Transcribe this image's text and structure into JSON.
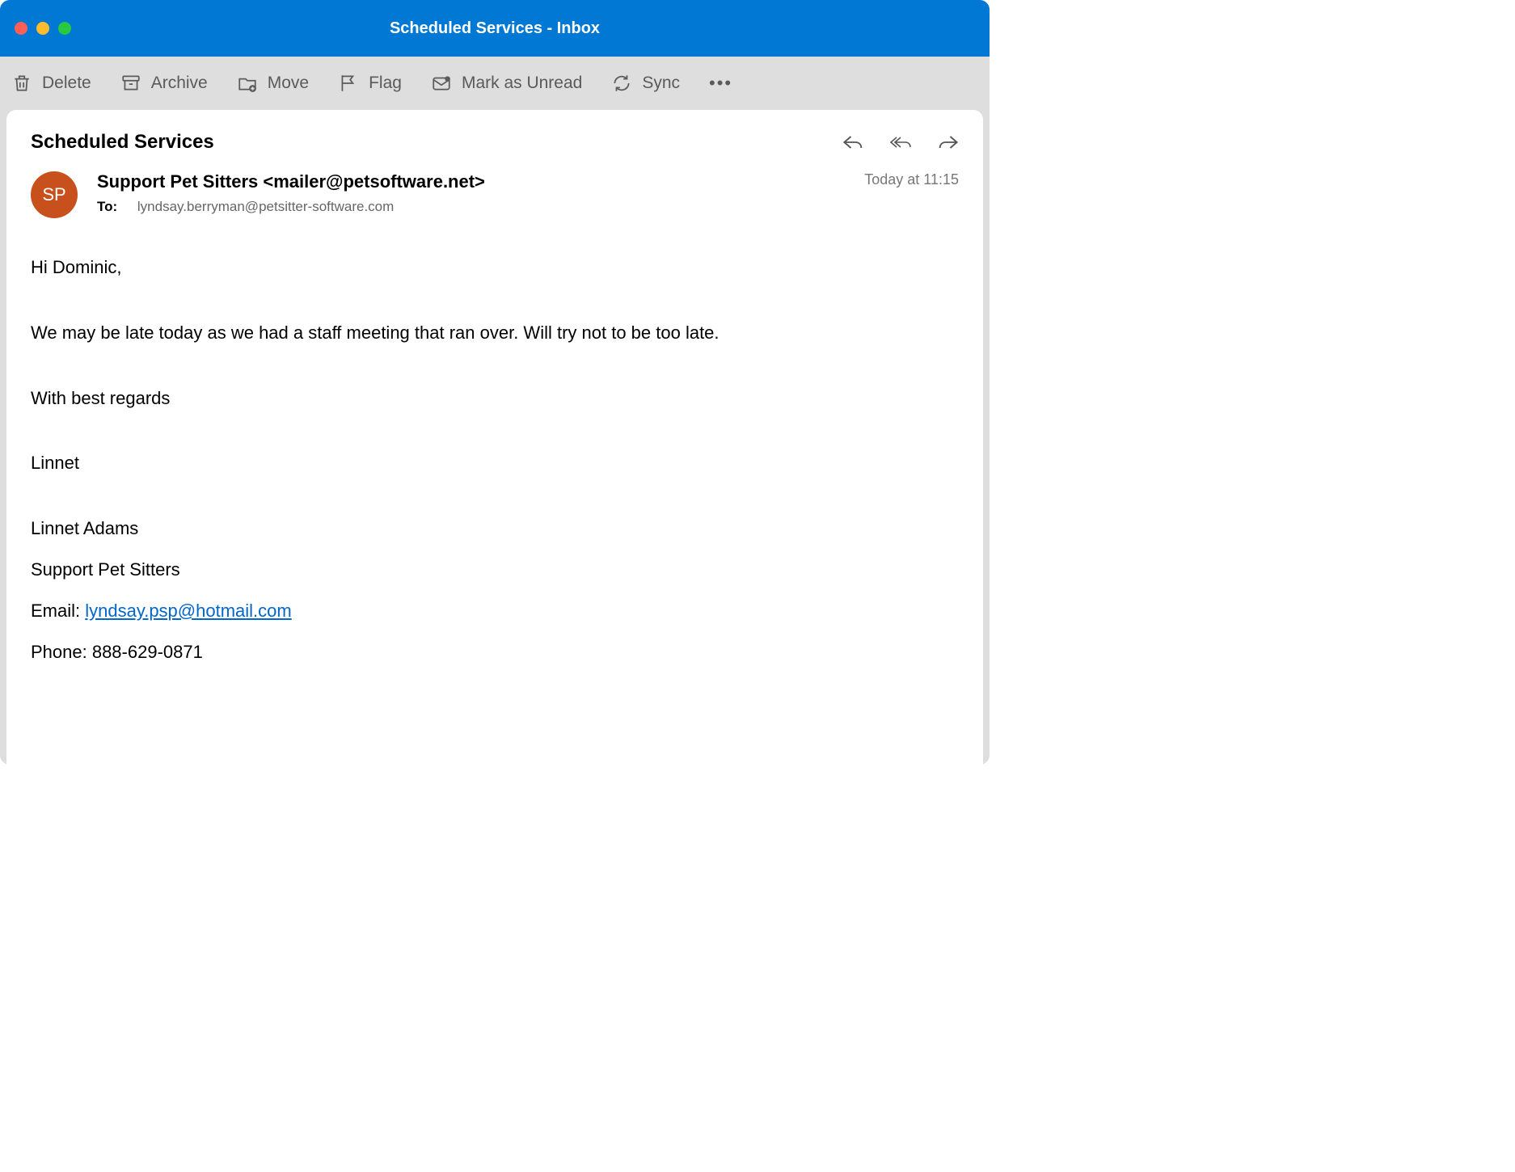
{
  "window": {
    "title": "Scheduled Services - Inbox"
  },
  "toolbar": {
    "delete": "Delete",
    "archive": "Archive",
    "move": "Move",
    "flag": "Flag",
    "unread": "Mark as Unread",
    "sync": "Sync"
  },
  "email": {
    "subject": "Scheduled Services",
    "avatar_initials": "SP",
    "sender": "Support Pet Sitters <mailer@petsoftware.net>",
    "to_label": "To:",
    "to_value": "lyndsay.berryman@petsitter-software.com",
    "timestamp": "Today at 11:15",
    "body": {
      "greeting": "Hi Dominic,",
      "para1": "We may be late today as we had a staff meeting that ran over. Will try not to be too late.",
      "closing": "With best regards",
      "sign_name": "Linnet"
    },
    "signature": {
      "name": "Linnet Adams",
      "company": "Support Pet Sitters",
      "email_label": "Email: ",
      "email_link": "lyndsay.psp@hotmail.com",
      "phone": "Phone: 888-629-0871"
    }
  }
}
